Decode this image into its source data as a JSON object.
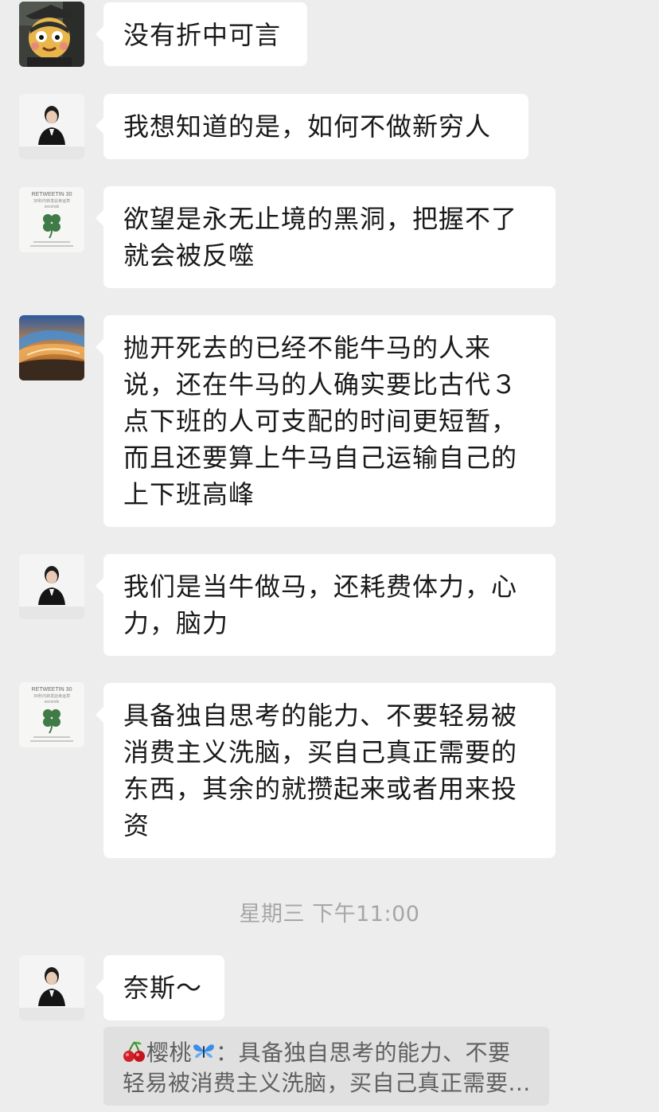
{
  "messages": [
    {
      "sender": "avatar-cartoon-ninja",
      "text": "没有折中可言"
    },
    {
      "sender": "avatar-woman-portrait",
      "text": "我想知道的是，如何不做新穷人"
    },
    {
      "sender": "avatar-clover-poster",
      "text": "欲望是永无止境的黑洞，把握不了\n就会被反噬"
    },
    {
      "sender": "avatar-ocean-wave",
      "text": "抛开死去的已经不能牛马的人来\n说，还在牛马的人确实要比古代３\n点下班的人可支配的时间更短暂，\n而且还要算上牛马自己运输自己的\n上下班高峰"
    },
    {
      "sender": "avatar-woman-portrait",
      "text": "我们是当牛做马，还耗费体力，心\n力，脑力"
    },
    {
      "sender": "avatar-clover-poster",
      "text": "具备独自思考的能力、不要轻易被\n消费主义洗脑，买自己真正需要的\n东西，其余的就攒起来或者用来投\n资"
    },
    {
      "sender": "avatar-woman-portrait",
      "text": "奈斯～"
    }
  ],
  "timestamp": "星期三 下午11:00",
  "avatar_texts": {
    "clover_title": "RETWEETIN 30",
    "clover_sub": "30秒内转发此幸运草",
    "clover_sub2": "seconds"
  },
  "quote": {
    "icon_left": "cherry-emoji",
    "name": "樱桃",
    "icon_right": "butterfly-emoji",
    "separator": "：",
    "line1_text": "具备独自思考的能力、不要",
    "line2": "轻易被消费主义洗脑，买自己真正需要..."
  },
  "colors": {
    "background": "#ededed",
    "bubble": "#ffffff",
    "quote_bg": "#e0e0e0",
    "timestamp": "#a6a6a6"
  }
}
